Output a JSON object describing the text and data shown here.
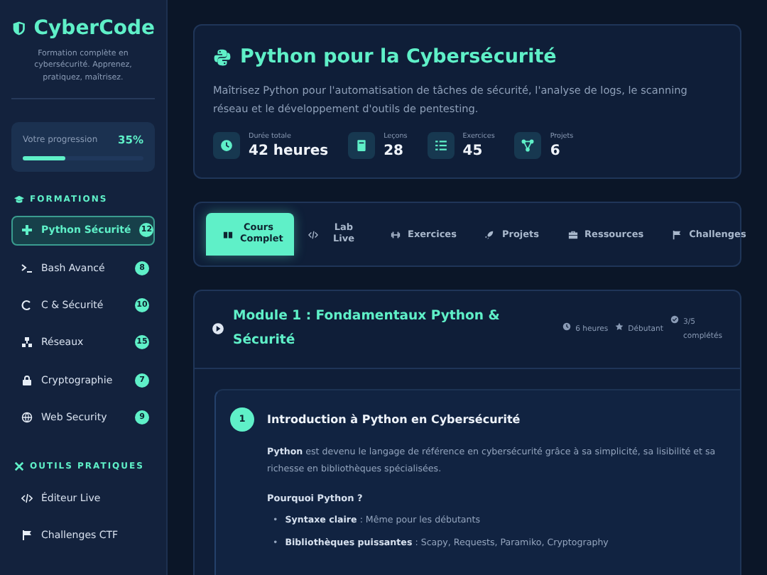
{
  "brand": {
    "name": "CyberCode",
    "tagline": "Formation complète en cybersécurité. Apprenez, pratiquez, maîtrisez."
  },
  "progress": {
    "label": "Votre progression",
    "value": "35%",
    "level": 0.35
  },
  "sections": [
    {
      "title": "FORMATIONS",
      "items": [
        {
          "label": "Python Sécurité",
          "badge": "12",
          "selected": true
        },
        {
          "label": "Bash Avancé",
          "badge": "8",
          "selected": false
        },
        {
          "label": "C & Sécurité",
          "badge": "10",
          "selected": false
        },
        {
          "label": "Réseaux",
          "badge": "15",
          "selected": false
        },
        {
          "label": "Cryptographie",
          "badge": "7",
          "selected": false
        },
        {
          "label": "Web Security",
          "badge": "9",
          "selected": false
        }
      ]
    },
    {
      "title": "OUTILS PRATIQUES",
      "items": [
        {
          "label": "Éditeur Live",
          "selected": false
        },
        {
          "label": "Challenges CTF",
          "selected": false
        }
      ]
    }
  ],
  "hero": {
    "title": "Python pour la Cybersécurité",
    "description": "Maîtrisez Python pour l'automatisation de tâches de sécurité, l'analyse de logs, le scanning réseau et le développement d'outils de pentesting.",
    "stats": [
      {
        "label": "Durée totale",
        "value": "42 heures"
      },
      {
        "label": "Leçons",
        "value": "28"
      },
      {
        "label": "Exercices",
        "value": "45"
      },
      {
        "label": "Projets",
        "value": "6"
      }
    ]
  },
  "tabs": [
    {
      "label": "Cours Complet",
      "selected": true
    },
    {
      "label": "Lab Live",
      "selected": false
    },
    {
      "label": "Exercices",
      "selected": false
    },
    {
      "label": "Projets",
      "selected": false
    },
    {
      "label": "Ressources",
      "selected": false
    },
    {
      "label": "Challenges",
      "selected": false
    }
  ],
  "module": {
    "title": "Module 1 : Fondamentaux Python & Sécurité",
    "meta": [
      "6 heures",
      "Débutant",
      "3/5 complétés"
    ],
    "lesson": {
      "number": "1",
      "title": "Introduction à Python en Cybersécurité",
      "intro": "**Python** est devenu le langage de référence en cybersécurité grâce à sa simplicité, sa lisibilité et sa richesse en bibliothèques spécialisées.",
      "subheading": "Pourquoi Python ?",
      "points": [
        {
          "marker": "•",
          "text": "**Syntaxe claire** : Même pour les débutants"
        },
        {
          "marker": "•",
          "text": "**Bibliothèques puissantes** : Scapy, Requests, Paramiko, Cryptography"
        }
      ]
    }
  }
}
